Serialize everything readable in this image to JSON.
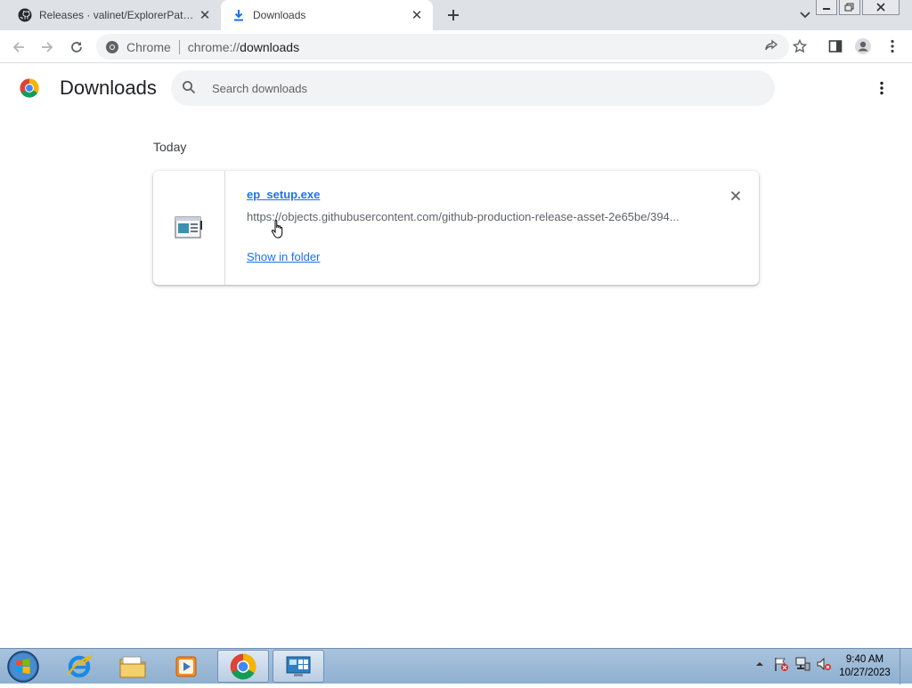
{
  "tabs": [
    {
      "title": "Releases · valinet/ExplorerPatcher",
      "icon": "github-icon",
      "active": false
    },
    {
      "title": "Downloads",
      "icon": "download-icon",
      "active": true
    }
  ],
  "toolbar": {
    "chip_label": "Chrome",
    "url_scheme": "chrome://",
    "url_host": "downloads"
  },
  "page": {
    "title": "Downloads",
    "search_placeholder": "Search downloads"
  },
  "downloads": {
    "date_header": "Today",
    "items": [
      {
        "filename": "ep_setup.exe",
        "url": "https://objects.githubusercontent.com/github-production-release-asset-2e65be/394...",
        "action_label": "Show in folder"
      }
    ]
  },
  "taskbar": {
    "clock_time": "9:40 AM",
    "clock_date": "10/27/2023",
    "apps": [
      "internet-explorer-icon",
      "file-explorer-icon",
      "media-player-icon",
      "chrome-icon",
      "control-panel-icon"
    ]
  },
  "colors": {
    "accent": "#1a73e8",
    "tabstrip": "#dee1e6",
    "omnibox": "#f1f3f4"
  }
}
